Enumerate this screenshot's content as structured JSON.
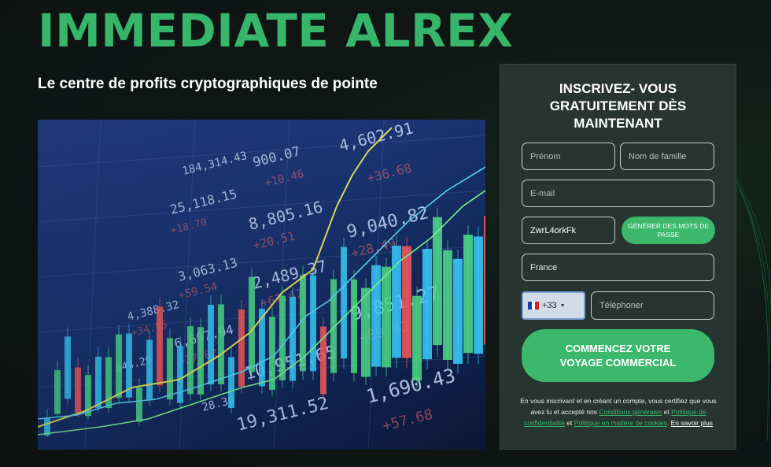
{
  "brand": {
    "name": "IMMEDIATE ALREX"
  },
  "hero": {
    "tagline": "Le centre de profits cryptographiques de pointe",
    "image_numbers": [
      "4,602.91",
      "900.07",
      "184,314.43",
      "+36.68",
      "+10.46",
      "25,118.15",
      "+18.70",
      "8,805.16",
      "+20.51",
      "9,040.82",
      "+28.49",
      "3,063.13",
      "+59.54",
      "2,489.37",
      "+67.47",
      "9,851.27",
      "+89.03",
      "4,388.32",
      "+34.85",
      "6,607.94",
      "+27.82",
      "10,951.65",
      "1,690.43",
      "+57.68",
      "844.29",
      "19,311.52",
      "28.36"
    ]
  },
  "form": {
    "title": "INSCRIVEZ- VOUS GRATUITEMENT DÈS MAINTENANT",
    "first_name_placeholder": "Prénom",
    "last_name_placeholder": "Nom de famille",
    "email_placeholder": "E-mail",
    "password_value": "ZwrL4orkFk",
    "generate_password_label": "GÉNÉRER DES MOTS DE PASSE",
    "country_value": "France",
    "dial_code": "+33",
    "phone_placeholder": "Téléphoner",
    "submit_line1": "COMMENCEZ VOTRE",
    "submit_line2": "VOYAGE COMMERCIAL",
    "legal_text_1": "En vous inscrivant et en créant un compte, vous certifiez que vous avez lu et accepté nos",
    "terms_link": "Conditions générales",
    "legal_and_1": "et",
    "privacy_link": "Politique de confidentialité",
    "legal_and_2": "et",
    "cookies_link": "Politique en matière de cookies",
    "learn_more_link": "En savoir plus"
  },
  "colors": {
    "accent": "#3bb86c",
    "brand_text": "#37b56a",
    "panel_bg": "#273430",
    "page_bg": "#0f1614"
  },
  "icons": {
    "country_flag": "france-flag-icon",
    "dropdown": "caret-down-icon"
  }
}
